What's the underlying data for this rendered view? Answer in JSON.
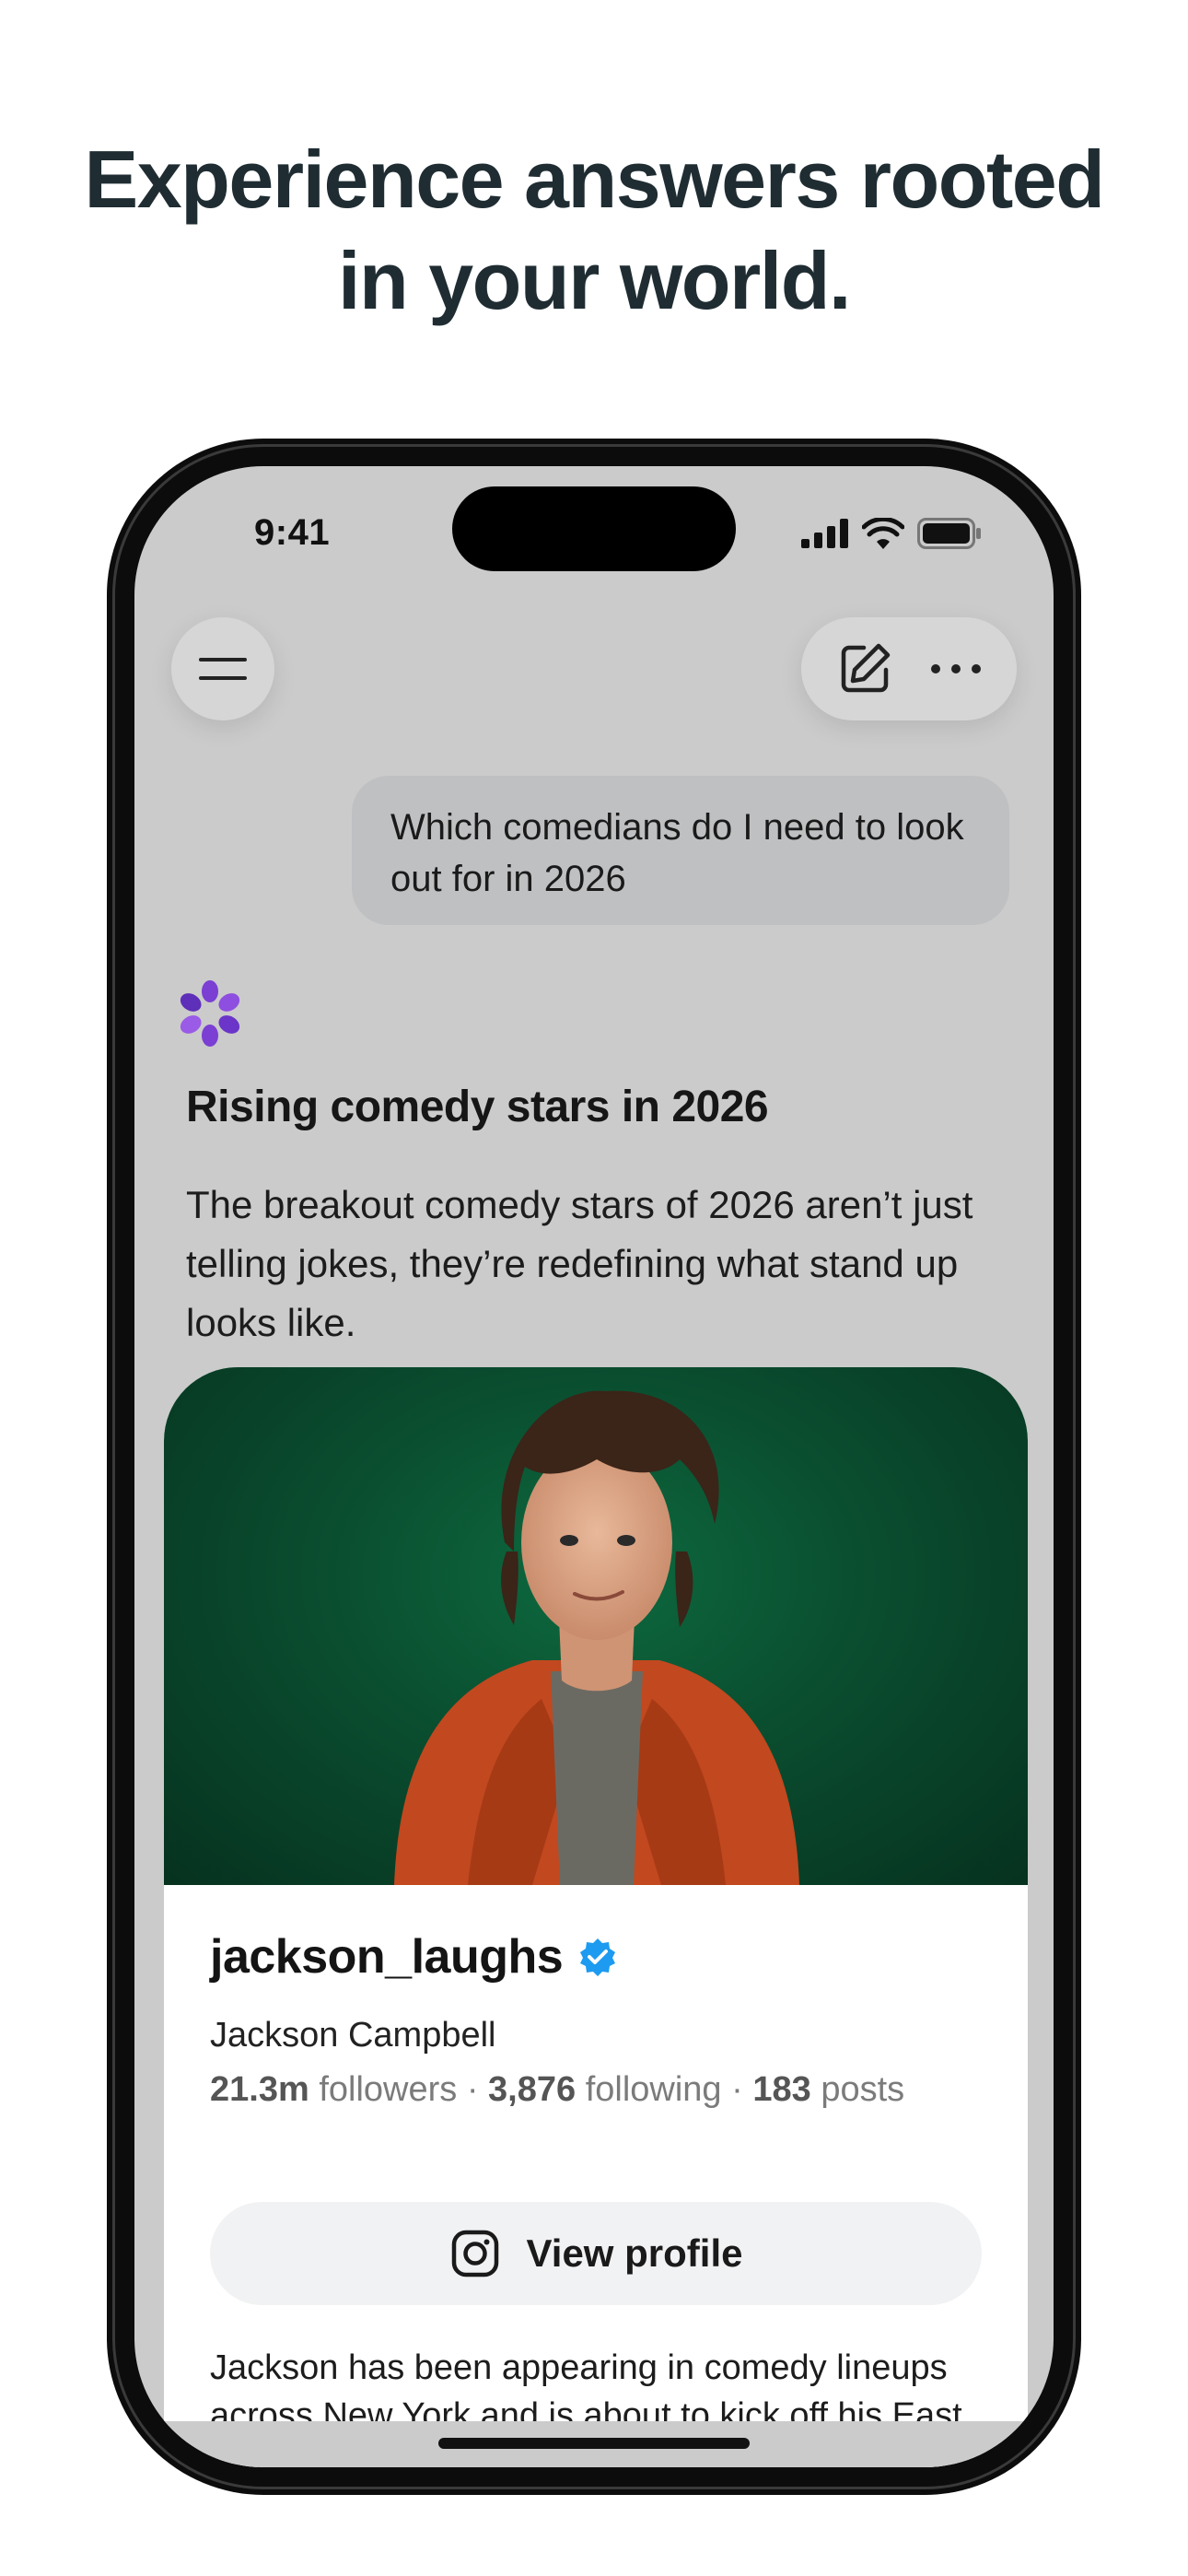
{
  "headline": {
    "line1": "Experience answers rooted",
    "line2": "in your world."
  },
  "status_bar": {
    "time": "9:41",
    "icons": [
      "signal-icon",
      "wifi-icon",
      "battery-icon"
    ]
  },
  "toolbar": {
    "menu_icon": "hamburger-menu-icon",
    "compose_icon": "compose-icon",
    "more_icon": "more-horizontal-icon"
  },
  "chat": {
    "user_message": "Which comedians do I need to look out for in 2026",
    "ai_icon": "ai-assistant-logo-icon",
    "answer_title": "Rising comedy stars in 2026",
    "answer_body": "The breakout comedy stars of 2026 aren’t just telling jokes, they’re redefining what stand up looks like."
  },
  "profile_card": {
    "handle": "jackson_laughs",
    "verified_icon": "verified-badge-icon",
    "full_name": "Jackson Campbell",
    "followers_value": "21.3m",
    "followers_label": "followers",
    "following_value": "3,876",
    "following_label": "following",
    "posts_value": "183",
    "posts_label": "posts",
    "separator": "·",
    "button_icon": "instagram-icon",
    "button_label": "View profile",
    "description": "Jackson has been appearing in comedy lineups across New York and is about to kick off his East Coast tour, bringing his signature mix of"
  },
  "colors": {
    "headline": "#1f2d33",
    "screen_bg": "#cbcbcb",
    "bubble_bg": "#bfc0c2",
    "photo_bg": "#0a4d2f",
    "ai_logo": "#7b3fd4",
    "verified": "#1d9bf0",
    "jacket": "#c2481f"
  }
}
